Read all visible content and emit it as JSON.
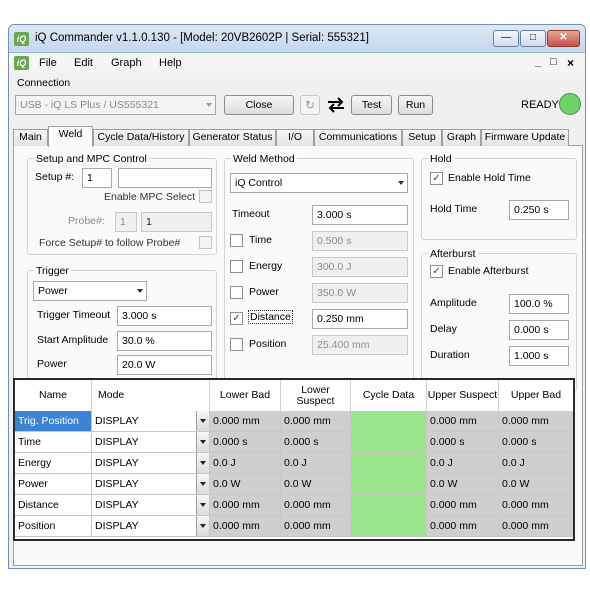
{
  "window": {
    "title": "iQ Commander v1.1.0.130 - [Model: 20VB2602P | Serial: 555321]",
    "icon_text": "iQ"
  },
  "menu": {
    "items": [
      "File",
      "Edit",
      "Graph",
      "Help"
    ],
    "doc_controls": [
      "_",
      "□",
      "×"
    ]
  },
  "connection": {
    "label": "Connection",
    "device": "USB - iQ LS Plus / US555321",
    "close_label": "Close",
    "test_label": "Test",
    "run_label": "Run",
    "status": "READY",
    "status_color": "#6fd36a"
  },
  "tabs": [
    "Main",
    "Weld",
    "Cycle Data/History",
    "Generator Status",
    "I/O",
    "Communications",
    "Setup",
    "Graph",
    "Firmware Update"
  ],
  "active_tab": "Weld",
  "setup": {
    "title": "Setup and MPC Control",
    "setup_label": "Setup #:",
    "setup_value": "1",
    "enable_mpc_label": "Enable MPC Select",
    "probe_label": "Probe#:",
    "probe_value": "1",
    "probe_value2": "1",
    "force_label": "Force Setup# to follow Probe#"
  },
  "trigger": {
    "title": "Trigger",
    "mode": "Power",
    "timeout_label": "Trigger Timeout",
    "timeout_value": "3.000 s",
    "start_amp_label": "Start Amplitude",
    "start_amp_value": "30.0 %",
    "power_label": "Power",
    "power_value": "20.0 W"
  },
  "weld_method": {
    "title": "Weld Method",
    "method": "iQ Control",
    "timeout_label": "Timeout",
    "timeout_value": "3.000 s",
    "time_label": "Time",
    "time_value": "0.500 s",
    "energy_label": "Energy",
    "energy_value": "300.0 J",
    "power_label": "Power",
    "power_value": "350.0 W",
    "distance_label": "Distance",
    "distance_value": "0.250 mm",
    "position_label": "Position",
    "position_value": "25.400 mm"
  },
  "hold": {
    "title": "Hold",
    "enable_label": "Enable Hold Time",
    "time_label": "Hold Time",
    "time_value": "0.250 s"
  },
  "afterburst": {
    "title": "Afterburst",
    "enable_label": "Enable Afterburst",
    "amp_label": "Amplitude",
    "amp_value": "100.0 %",
    "delay_label": "Delay",
    "delay_value": "0.000 s",
    "duration_label": "Duration",
    "duration_value": "1.000 s"
  },
  "limits": {
    "headers": [
      "Name",
      "Mode",
      "Lower Bad",
      "Lower Suspect",
      "Cycle Data",
      "Upper Suspect",
      "Upper Bad"
    ],
    "rows": [
      {
        "name": "Trig. Position",
        "mode": "DISPLAY",
        "lower_bad": "0.000 mm",
        "lower_suspect": "0.000 mm",
        "cycle": "",
        "upper_suspect": "0.000 mm",
        "upper_bad": "0.000 mm"
      },
      {
        "name": "Time",
        "mode": "DISPLAY",
        "lower_bad": "0.000 s",
        "lower_suspect": "0.000 s",
        "cycle": "",
        "upper_suspect": "0.000 s",
        "upper_bad": "0.000 s"
      },
      {
        "name": "Energy",
        "mode": "DISPLAY",
        "lower_bad": "0.0 J",
        "lower_suspect": "0.0 J",
        "cycle": "",
        "upper_suspect": "0.0 J",
        "upper_bad": "0.0 J"
      },
      {
        "name": "Power",
        "mode": "DISPLAY",
        "lower_bad": "0.0 W",
        "lower_suspect": "0.0 W",
        "cycle": "",
        "upper_suspect": "0.0 W",
        "upper_bad": "0.0 W"
      },
      {
        "name": "Distance",
        "mode": "DISPLAY",
        "lower_bad": "0.000 mm",
        "lower_suspect": "0.000 mm",
        "cycle": "",
        "upper_suspect": "0.000 mm",
        "upper_bad": "0.000 mm"
      },
      {
        "name": "Position",
        "mode": "DISPLAY",
        "lower_bad": "0.000 mm",
        "lower_suspect": "0.000 mm",
        "cycle": "",
        "upper_suspect": "0.000 mm",
        "upper_bad": "0.000 mm"
      }
    ]
  }
}
